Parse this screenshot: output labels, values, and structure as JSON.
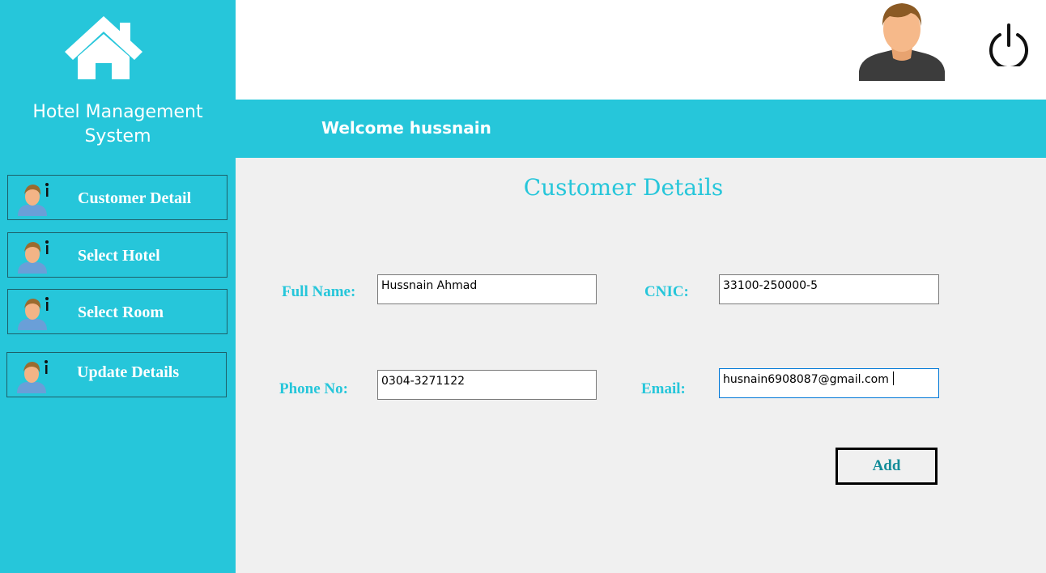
{
  "sidebar": {
    "title": "Hotel Management System",
    "items": [
      {
        "label": "Customer Detail"
      },
      {
        "label": "Select Hotel"
      },
      {
        "label": "Select Room"
      },
      {
        "label": "Update Details"
      }
    ],
    "icons": {
      "logo": "home-icon",
      "item": "user-info-icon"
    }
  },
  "header": {
    "welcome": "Welcome hussnain",
    "icons": {
      "avatar": "user-avatar",
      "power": "power-icon"
    }
  },
  "form": {
    "title": "Customer Details",
    "full_name": {
      "label": "Full Name:",
      "value": "Hussnain Ahmad"
    },
    "cnic": {
      "label": "CNIC:",
      "value": "33100-250000-5"
    },
    "phone": {
      "label": "Phone No:",
      "value": "0304-3271122"
    },
    "email": {
      "label": "Email:",
      "value": "husnain6908087@gmail.com"
    },
    "add_label": "Add"
  },
  "colors": {
    "accent": "#26c6da",
    "background": "#f0f0f0",
    "header": "#ffffff",
    "button_text": "#138c99"
  }
}
